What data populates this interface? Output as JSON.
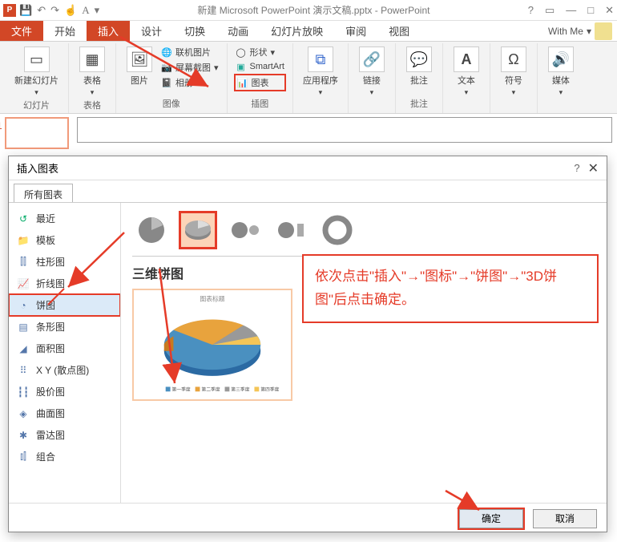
{
  "titlebar": {
    "title": "新建 Microsoft PowerPoint 演示文稿.pptx - PowerPoint"
  },
  "ribbon_tabs": {
    "file": "文件",
    "home": "开始",
    "insert": "插入",
    "design": "设计",
    "transition": "切换",
    "animation": "动画",
    "slideshow": "幻灯片放映",
    "review": "审阅",
    "view": "视图",
    "with_me": "With Me"
  },
  "ribbon": {
    "new_slide": "新建幻灯片",
    "slides_label": "幻灯片",
    "table": "表格",
    "tables_label": "表格",
    "picture": "图片",
    "online_pic": "联机图片",
    "screenshot": "屏幕截图",
    "album": "相册",
    "images_label": "图像",
    "shapes": "形状",
    "smartart": "SmartArt",
    "chart": "图表",
    "illustrations_label": "插图",
    "apps": "应用程序",
    "links": "链接",
    "comments": "批注",
    "comments_label": "批注",
    "text": "文本",
    "symbols": "符号",
    "media": "媒体"
  },
  "dialog": {
    "title": "插入图表",
    "all_charts_tab": "所有图表",
    "categories": {
      "recent": "最近",
      "templates": "模板",
      "column": "柱形图",
      "line": "折线图",
      "pie": "饼图",
      "bar": "条形图",
      "area": "面积图",
      "scatter": "X Y (散点图)",
      "stock": "股价图",
      "surface": "曲面图",
      "radar": "雷达图",
      "combo": "组合"
    },
    "subtype_title": "三维饼图",
    "preview_title": "图表标题",
    "legend": [
      "第一季度",
      "第二季度",
      "第三季度",
      "第四季度"
    ],
    "ok": "确定",
    "cancel": "取消"
  },
  "annotation": "依次点击\"插入\"→\"图标\"→\"饼图\"→\"3D饼图\"后点击确定。",
  "chart_data": {
    "type": "pie",
    "title": "图表标题",
    "categories": [
      "第一季度",
      "第二季度",
      "第三季度",
      "第四季度"
    ],
    "values": [
      58,
      23,
      10,
      9
    ],
    "style": "3d"
  }
}
